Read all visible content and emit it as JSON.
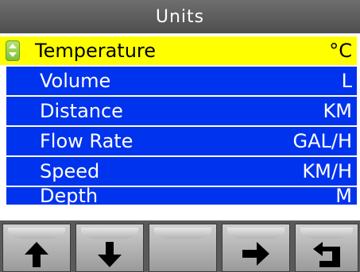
{
  "title": "Units",
  "rows": [
    {
      "label": "Temperature",
      "value": "°C",
      "selected": true
    },
    {
      "label": "Volume",
      "value": "L",
      "selected": false
    },
    {
      "label": "Distance",
      "value": "KM",
      "selected": false
    },
    {
      "label": "Flow Rate",
      "value": "GAL/H",
      "selected": false
    },
    {
      "label": "Speed",
      "value": "KM/H",
      "selected": false
    },
    {
      "label": "Depth",
      "value": "M",
      "selected": false
    }
  ],
  "softkeys": [
    {
      "icon": "arrow-up-icon"
    },
    {
      "icon": "arrow-down-icon"
    },
    {
      "icon": ""
    },
    {
      "icon": "arrow-right-icon"
    },
    {
      "icon": "back-return-icon"
    }
  ],
  "colors": {
    "row_bg": "#0033ee",
    "selected_bg": "#ffff00",
    "title_bg": "#5a5a5a"
  }
}
